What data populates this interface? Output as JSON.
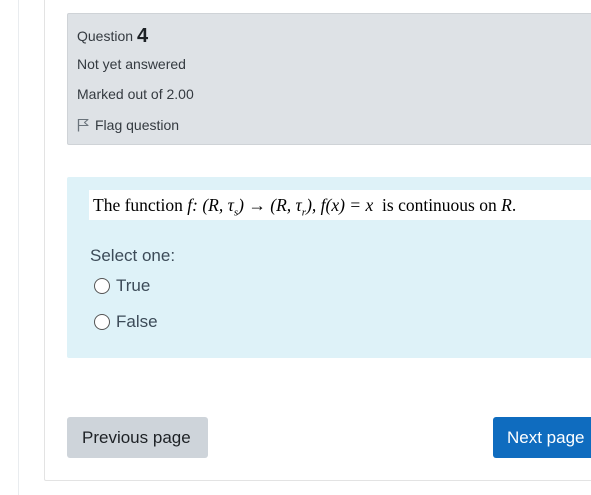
{
  "question_info": {
    "title_prefix": "Question",
    "number": "4",
    "state": "Not yet answered",
    "grade": "Marked out of 2.00",
    "flag_label": "Flag question"
  },
  "question": {
    "text_lead": "The function ",
    "text_math": "f: (R, τ",
    "sub_s": "s",
    "text_math2": ") → (R, τ",
    "sub_r": "r",
    "text_math3": "), f(x) = x",
    "text_tail": "  is continuous on ",
    "text_R": "R",
    "text_end": ".",
    "select_label": "Select one:",
    "options": [
      {
        "label": "True",
        "selected": false
      },
      {
        "label": "False",
        "selected": false
      }
    ]
  },
  "navigation": {
    "previous_label": "Previous page",
    "next_label": "Next page"
  },
  "colors": {
    "info_bg": "#dee2e6",
    "content_bg": "#def2f8",
    "next_button": "#0f6cbf",
    "prev_button": "#ced4da"
  }
}
